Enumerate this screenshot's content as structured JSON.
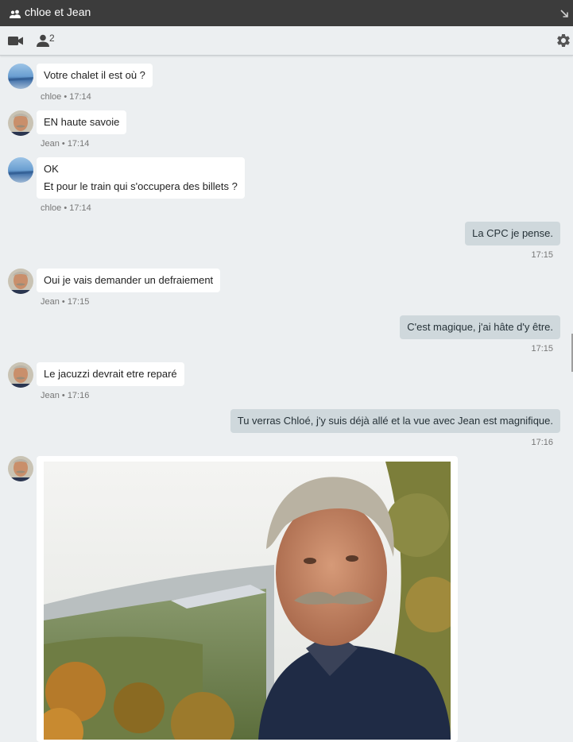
{
  "window": {
    "title": "chloe et Jean",
    "icon": "group-icon",
    "minimize_icon": "minimize-arrow-icon"
  },
  "toolbar": {
    "video_icon": "video-camera-icon",
    "participants_icon": "person-icon",
    "participants_count": "2",
    "settings_icon": "gear-icon"
  },
  "messages": [
    {
      "sender": "chloe",
      "direction": "in",
      "lines": [
        "Votre chalet il est où ?"
      ],
      "meta": "chloe • 17:14"
    },
    {
      "sender": "Jean",
      "direction": "in",
      "lines": [
        "EN haute savoie"
      ],
      "meta": "Jean • 17:14"
    },
    {
      "sender": "chloe",
      "direction": "in",
      "lines": [
        "OK",
        "Et pour le train qui s'occupera des billets ?"
      ],
      "meta": "chloe • 17:14"
    },
    {
      "sender": "me",
      "direction": "out",
      "lines": [
        "La CPC je pense."
      ],
      "meta": "17:15"
    },
    {
      "sender": "Jean",
      "direction": "in",
      "lines": [
        "Oui je vais demander un defraiement"
      ],
      "meta": "Jean • 17:15"
    },
    {
      "sender": "me",
      "direction": "out",
      "lines": [
        "C'est magique, j'ai hâte d'y être."
      ],
      "meta": "17:15"
    },
    {
      "sender": "Jean",
      "direction": "in",
      "lines": [
        "Le jacuzzi devrait etre reparé"
      ],
      "meta": "Jean • 17:16"
    },
    {
      "sender": "me",
      "direction": "out",
      "lines": [
        "Tu verras Chloé, j'y suis déjà allé et la vue avec Jean est magnifique."
      ],
      "meta": "17:16"
    },
    {
      "sender": "Jean",
      "direction": "in",
      "type": "image",
      "image": "photo-of-man-with-mustache-in-landscape"
    }
  ]
}
